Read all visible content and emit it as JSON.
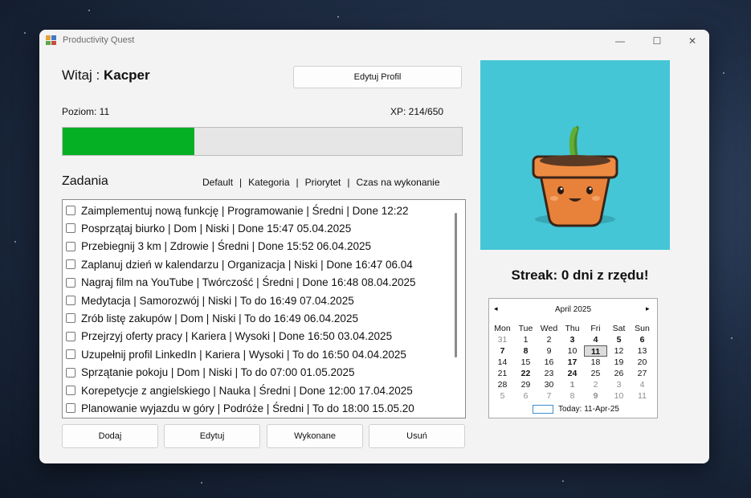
{
  "window": {
    "title": "Productivity Quest",
    "minimize": "—",
    "maximize": "☐",
    "close": "✕"
  },
  "profile": {
    "greeting": "Witaj :",
    "name": "Kacper",
    "edit_button": "Edytuj Profil",
    "level_text": "Poziom: 11",
    "xp_text": "XP: 214/650",
    "progress_fraction": 0.329
  },
  "tasks": {
    "title": "Zadania",
    "sort_options": [
      "Default",
      "Kategoria",
      "Priorytet",
      "Czas na wykonanie"
    ],
    "items": [
      "Zaimplementuj nową funkcję | Programowanie  | Średni | Done    12:22",
      "Posprzątaj biurko | Dom  | Niski | Done    15:47  05.04.2025",
      "Przebiegnij 3 km | Zdrowie  | Średni | Done    15:52  06.04.2025",
      "Zaplanuj dzień w kalendarzu | Organizacja  | Niski | Done    16:47  06.04",
      "Nagraj film na YouTube | Twórczość  | Średni | Done    16:48  08.04.2025",
      "Medytacja | Samorozwój  | Niski | To do    16:49  07.04.2025",
      "Zrób listę zakupów | Dom  | Niski | To do    16:49  06.04.2025",
      "Przejrzyj oferty pracy | Kariera  | Wysoki | Done    16:50  03.04.2025",
      "Uzupełnij profil LinkedIn | Kariera  | Wysoki | To do    16:50  04.04.2025",
      "Sprzątanie pokoju | Dom  | Niski | To do    07:00  01.05.2025",
      "Korepetycje z angielskiego | Nauka  | Średni | Done    12:00  17.04.2025",
      "Planowanie wyjazdu w góry | Podróże  | Średni | To do    18:00  15.05.20"
    ],
    "buttons": {
      "add": "Dodaj",
      "edit": "Edytuj",
      "done": "Wykonane",
      "delete": "Usuń"
    }
  },
  "streak_text": "Streak: 0 dni z rzędu!",
  "calendar": {
    "month_label": "April 2025",
    "prev": "◂",
    "next": "▸",
    "weekdays": [
      "Mon",
      "Tue",
      "Wed",
      "Thu",
      "Fri",
      "Sat",
      "Sun"
    ],
    "weeks": [
      [
        "31",
        "1",
        "2",
        "3",
        "4",
        "5",
        "6"
      ],
      [
        "7",
        "8",
        "9",
        "10",
        "11",
        "12",
        "13"
      ],
      [
        "14",
        "15",
        "16",
        "17",
        "18",
        "19",
        "20"
      ],
      [
        "21",
        "22",
        "23",
        "24",
        "25",
        "26",
        "27"
      ],
      [
        "28",
        "29",
        "30",
        "1",
        "2",
        "3",
        "4"
      ],
      [
        "5",
        "6",
        "7",
        "8",
        "9",
        "10",
        "11"
      ]
    ],
    "bold_days": [
      "3",
      "4",
      "5",
      "6",
      "7",
      "8",
      "17",
      "22",
      "24",
      "1",
      "9"
    ],
    "selected_day": "11",
    "today_label": "Today: 11-Apr-25"
  }
}
